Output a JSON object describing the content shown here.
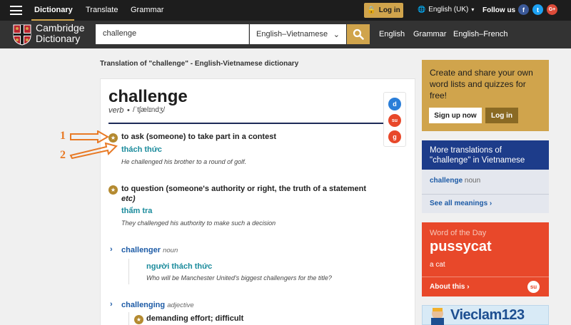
{
  "topbar": {
    "brand": "Dictionary",
    "translate": "Translate",
    "grammar": "Grammar",
    "login": "Log in",
    "language": "English (UK)",
    "follow": "Follow us",
    "social": [
      "f",
      "t",
      "G+"
    ]
  },
  "header": {
    "logo_line1": "Cambridge",
    "logo_line2": "Dictionary",
    "search_value": "challenge",
    "dictionary_selected": "English–Vietnamese",
    "links": [
      "English",
      "Grammar",
      "English–French"
    ]
  },
  "page": {
    "heading": "Translation of \"challenge\" - English-Vietnamese dictionary"
  },
  "entry": {
    "headword": "challenge",
    "pos": "verb",
    "bullet": "•",
    "pronunciation": "/ˈtʃælɪndʒ/",
    "tools": [
      "d",
      "su",
      "g"
    ],
    "senses": [
      {
        "definition": "to ask (someone) to take part in a contest",
        "translation": "thách thức",
        "example": "He challenged his brother to a round of golf."
      },
      {
        "definition_line1": "to question (someone's authority or right, the truth of a statement",
        "definition_line2": "etc)",
        "translation": "thẩm tra",
        "example": "They challenged his authority to make such a decision"
      }
    ],
    "runons": [
      {
        "word": "challenger",
        "pos": "noun",
        "translation": "người thách thức",
        "example": "Who will be Manchester United's biggest challengers for the title?"
      },
      {
        "word": "challenging",
        "pos": "adjective",
        "definition": "demanding effort; difficult"
      }
    ]
  },
  "annotations": {
    "one": "1",
    "two": "2"
  },
  "sidebar": {
    "promo_text": "Create and share your own word lists and quizzes for free!",
    "signup": "Sign up now",
    "login": "Log in",
    "more_title": "More translations of \"challenge\" in Vietnamese",
    "more_word": "challenge",
    "more_pos": "noun",
    "see_all": "See all meanings ›",
    "wotd_label": "Word of the Day",
    "wotd_word": "pussycat",
    "wotd_def": "a cat",
    "about": "About this ›",
    "ad_text": "Vieclam123"
  },
  "colors": {
    "accent_gold": "#d0a44c",
    "navy": "#1d2a57",
    "link_blue": "#1d5ba6",
    "translation_teal": "#1a8b9c",
    "wotd_red": "#e8482a",
    "annotation_orange": "#e87a26"
  }
}
